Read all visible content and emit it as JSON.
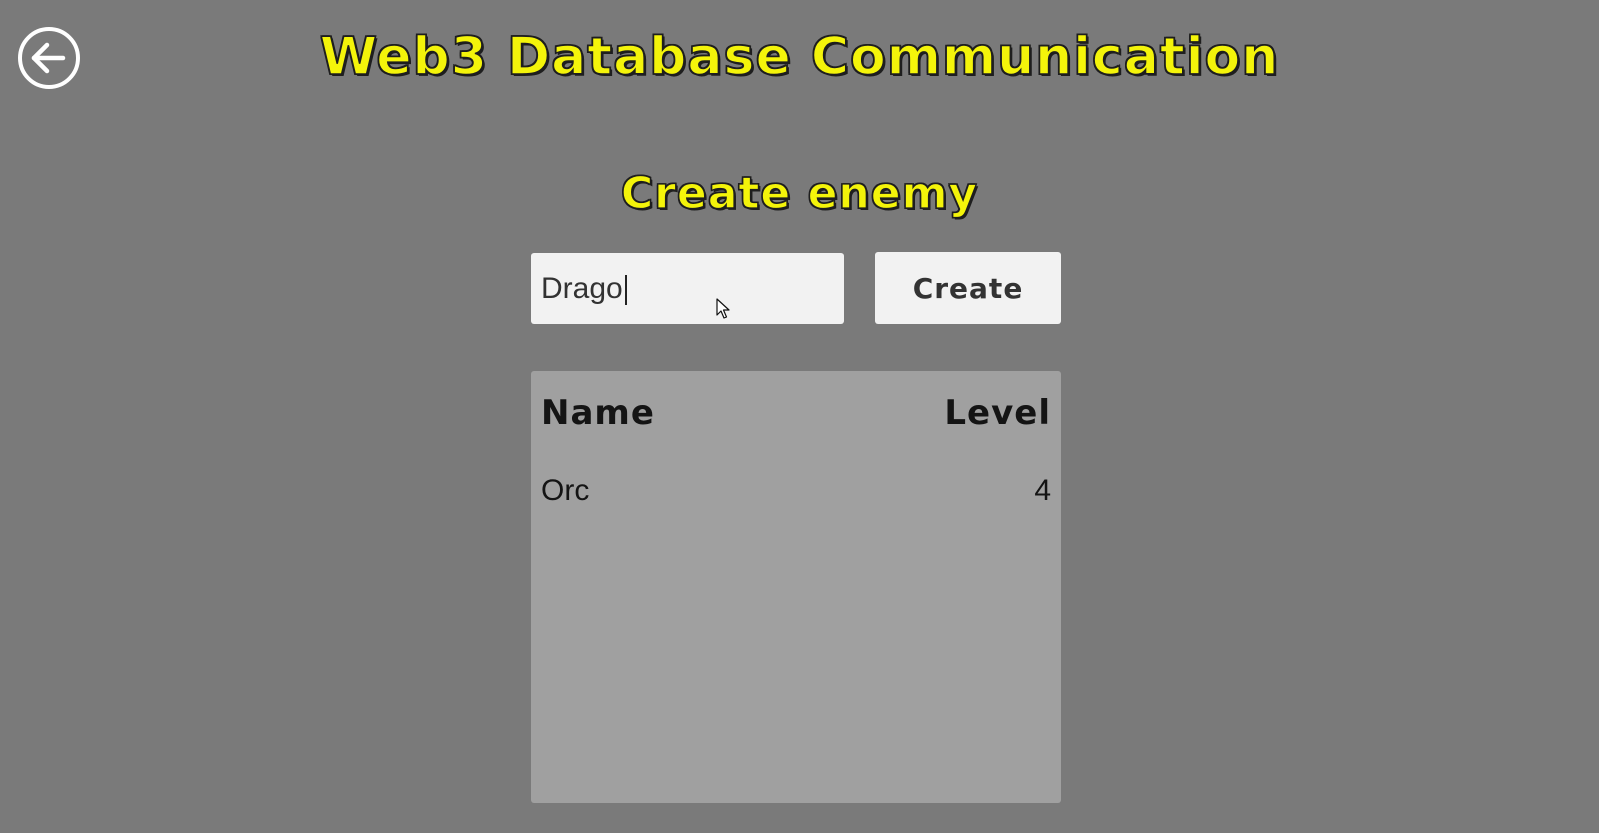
{
  "app": {
    "title": "Web3 Database Communication"
  },
  "nav": {
    "back_icon": "arrow-left-circle-icon"
  },
  "create_enemy": {
    "heading": "Create enemy",
    "name_input_value": "Drago",
    "create_label": "Create"
  },
  "enemy_table": {
    "columns": [
      "Name",
      "Level"
    ],
    "rows": [
      {
        "name": "Orc",
        "level": "4"
      }
    ]
  },
  "colors": {
    "background": "#7a7a7a",
    "title_yellow": "#f4f40a",
    "panel": "#a0a0a0",
    "control": "#f2f2f2"
  }
}
